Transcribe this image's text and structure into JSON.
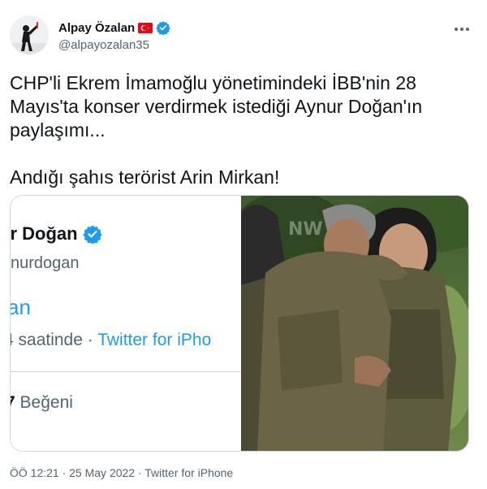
{
  "author": {
    "display_name": "Alpay Özalan",
    "handle": "@alpayozalan35",
    "flag_icon": "turkey-flag-icon",
    "verified_icon": "verified-badge-icon"
  },
  "more_icon": "more-horizontal-icon",
  "tweet": {
    "text": "CHP'li Ekrem İmamoğlu yönetimindeki İBB'nin 28 Mayıs'ta konser verdirmek istediği Aynur Doğan'ın paylaşımı...\n\nAndığı şahıs terörist Arin Mirkan!"
  },
  "embedded_screenshot": {
    "name": "ur Doğan",
    "handle": "ynurdogan",
    "partial_text": "an",
    "time_prefix": "4 saatinde · ",
    "source": "Twitter for iPho",
    "likes_count": "7",
    "likes_label": " Beğeni"
  },
  "photo_watermark": "NW",
  "meta": {
    "timestamp": "ÖÖ 12:21 · 25 May 2022 · Twitter for iPhone"
  },
  "colors": {
    "accent": "#1d9bf0",
    "text": "#0f1419",
    "secondary": "#536471",
    "border": "#cfd9de"
  }
}
